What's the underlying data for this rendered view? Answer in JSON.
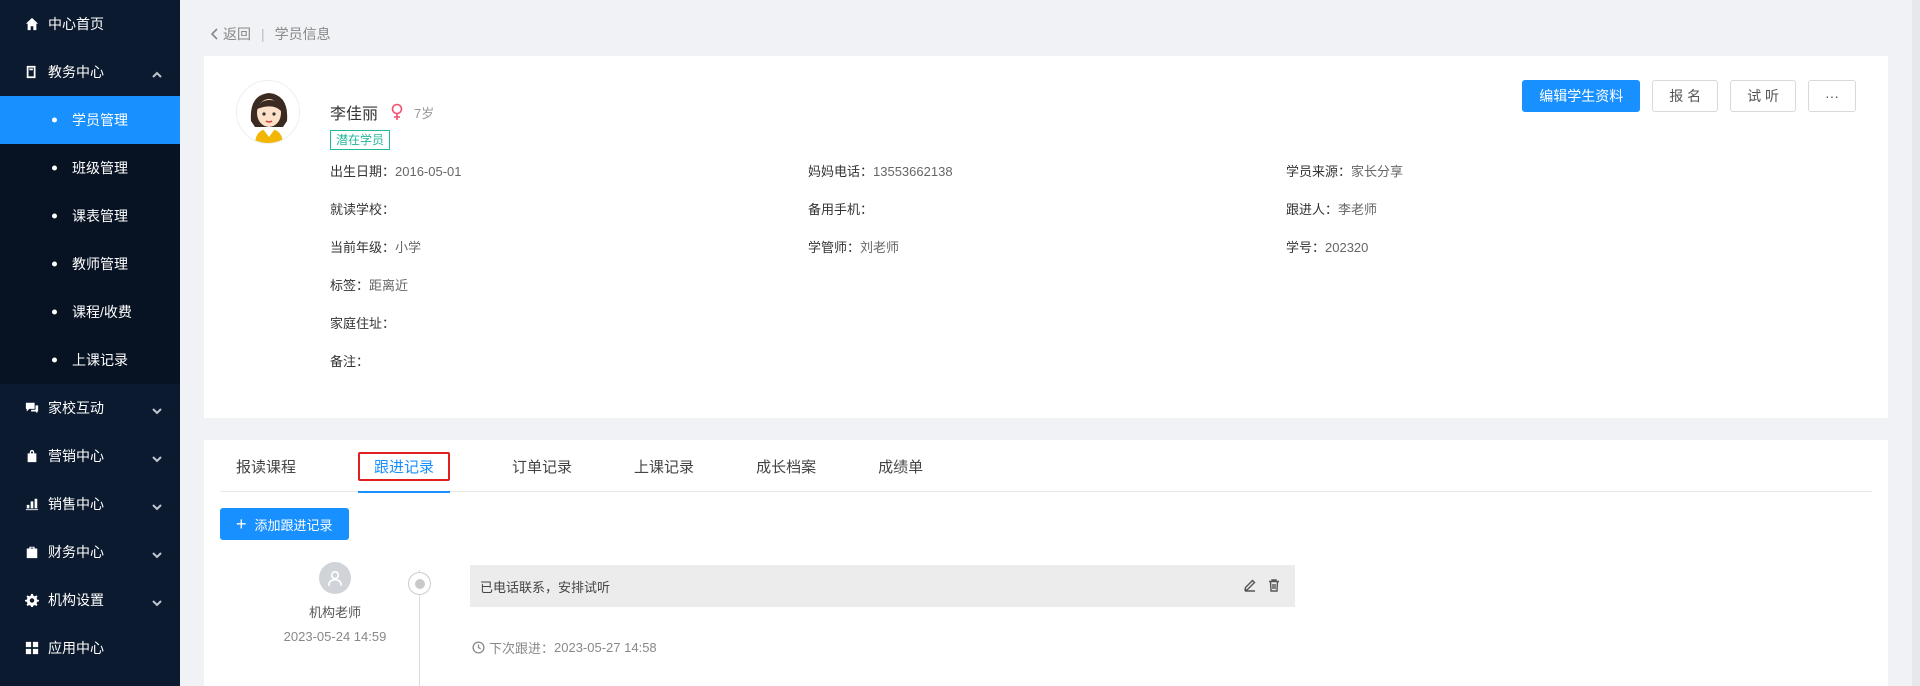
{
  "sidebar": {
    "items": [
      {
        "label": "中心首页",
        "icon": "home-icon"
      },
      {
        "label": "教务中心",
        "icon": "book-icon",
        "expanded": true
      },
      {
        "label": "家校互动",
        "icon": "chat-icon"
      },
      {
        "label": "营销中心",
        "icon": "bag-icon"
      },
      {
        "label": "销售中心",
        "icon": "chart-icon"
      },
      {
        "label": "财务中心",
        "icon": "wallet-icon"
      },
      {
        "label": "机构设置",
        "icon": "gear-icon"
      },
      {
        "label": "应用中心",
        "icon": "grid-icon"
      }
    ],
    "sub_items": [
      "学员管理",
      "班级管理",
      "课表管理",
      "教师管理",
      "课程/收费",
      "上课记录"
    ],
    "active_sub": "学员管理"
  },
  "breadcrumb": {
    "back": "返回",
    "sep": "|",
    "current": "学员信息"
  },
  "student": {
    "name": "李佳丽",
    "age": "7岁",
    "status_tag": "潜在学员",
    "gender_color": "#f0506e"
  },
  "actions": {
    "edit": "编辑学生资料",
    "enroll": "报 名",
    "trial": "试 听",
    "more": "···"
  },
  "info": {
    "birth_label": "出生日期：",
    "birth": "2016-05-01",
    "mom_label": "妈妈电话：",
    "mom": "13553662138",
    "source_label": "学员来源：",
    "source": "家长分享",
    "school_label": "就读学校：",
    "school": "",
    "backup_label": "备用手机：",
    "backup": "",
    "follow_label": "跟进人：",
    "follow": "李老师",
    "grade_label": "当前年级：",
    "grade": "小学",
    "manager_label": "学管师：",
    "manager": "刘老师",
    "no_label": "学号：",
    "no": "202320",
    "tags_label": "标签：",
    "tags": "距离近",
    "address_label": "家庭住址：",
    "address": "",
    "note_label": "备注：",
    "note": ""
  },
  "tabs": [
    "报读课程",
    "跟进记录",
    "订单记录",
    "上课记录",
    "成长档案",
    "成绩单"
  ],
  "active_tab": "跟进记录",
  "add_record": "添加跟进记录",
  "record": {
    "user": "机构老师",
    "time": "2023-05-24 14:59",
    "content": "已电话联系，安排试听",
    "next_label": "下次跟进：",
    "next_time": "2023-05-27 14:58"
  },
  "colors": {
    "primary": "#1890ff",
    "sidebar": "#0b1a2e",
    "highlight": "#e02020",
    "tag": "#23b89a"
  }
}
